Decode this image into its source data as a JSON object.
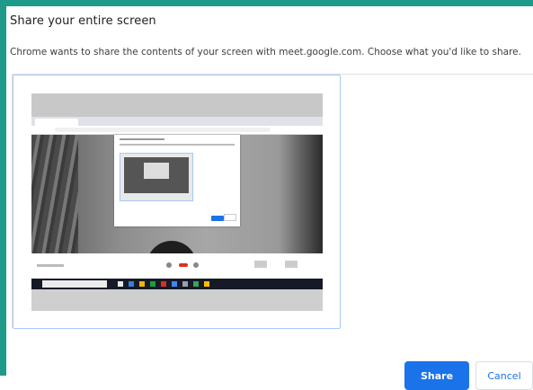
{
  "dialog": {
    "title": "Share your entire screen",
    "description": "Chrome wants to share the contents of your screen with meet.google.com. Choose what you'd like to share."
  },
  "picker": {
    "selected_item": "entire-screen-thumbnail"
  },
  "actions": {
    "share_label": "Share",
    "cancel_label": "Cancel"
  },
  "colors": {
    "accent": "#1a73e8",
    "backdrop": "#1f9a8a",
    "selection_border": "#a8c7fa"
  }
}
